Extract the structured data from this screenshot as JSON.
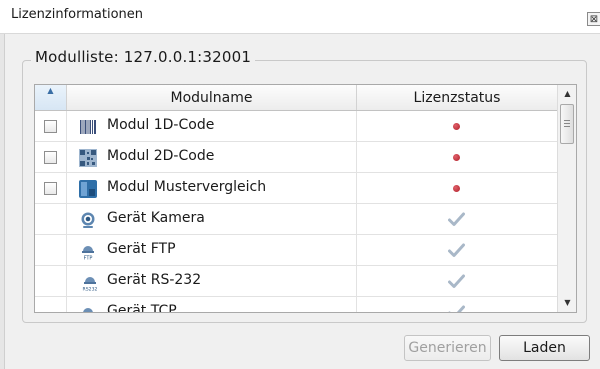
{
  "window": {
    "title": "Lizenzinformationen",
    "close_glyph": "⊠"
  },
  "group": {
    "title": "Modulliste: 127.0.0.1:32001"
  },
  "table": {
    "sort_indicator": "▲",
    "columns": [
      "Modulname",
      "Lizenzstatus"
    ],
    "rows": [
      {
        "label": "Modul 1D-Code",
        "icon": "barcode-icon",
        "has_checkbox": true,
        "status": "not-licensed"
      },
      {
        "label": "Modul 2D-Code",
        "icon": "qr-code-icon",
        "has_checkbox": true,
        "status": "not-licensed"
      },
      {
        "label": "Modul Mustervergleich",
        "icon": "pattern-match-icon",
        "has_checkbox": true,
        "status": "not-licensed"
      },
      {
        "label": "Gerät Kamera",
        "icon": "camera-icon",
        "has_checkbox": false,
        "status": "licensed"
      },
      {
        "label": "Gerät FTP",
        "icon": "ftp-device-icon",
        "has_checkbox": false,
        "status": "licensed"
      },
      {
        "label": "Gerät RS-232",
        "icon": "rs232-device-icon",
        "has_checkbox": false,
        "status": "licensed"
      },
      {
        "label": "Gerät TCP",
        "icon": "tcp-device-icon",
        "has_checkbox": false,
        "status": "licensed"
      }
    ],
    "scroll_up_glyph": "▲",
    "scroll_down_glyph": "▼"
  },
  "buttons": {
    "generate_label": "Generieren",
    "load_label": "Laden"
  },
  "colors": {
    "not_licensed_dot": "#b0202a",
    "licensed_check": "#a9b8c8",
    "accent": "#3a6ea5"
  }
}
